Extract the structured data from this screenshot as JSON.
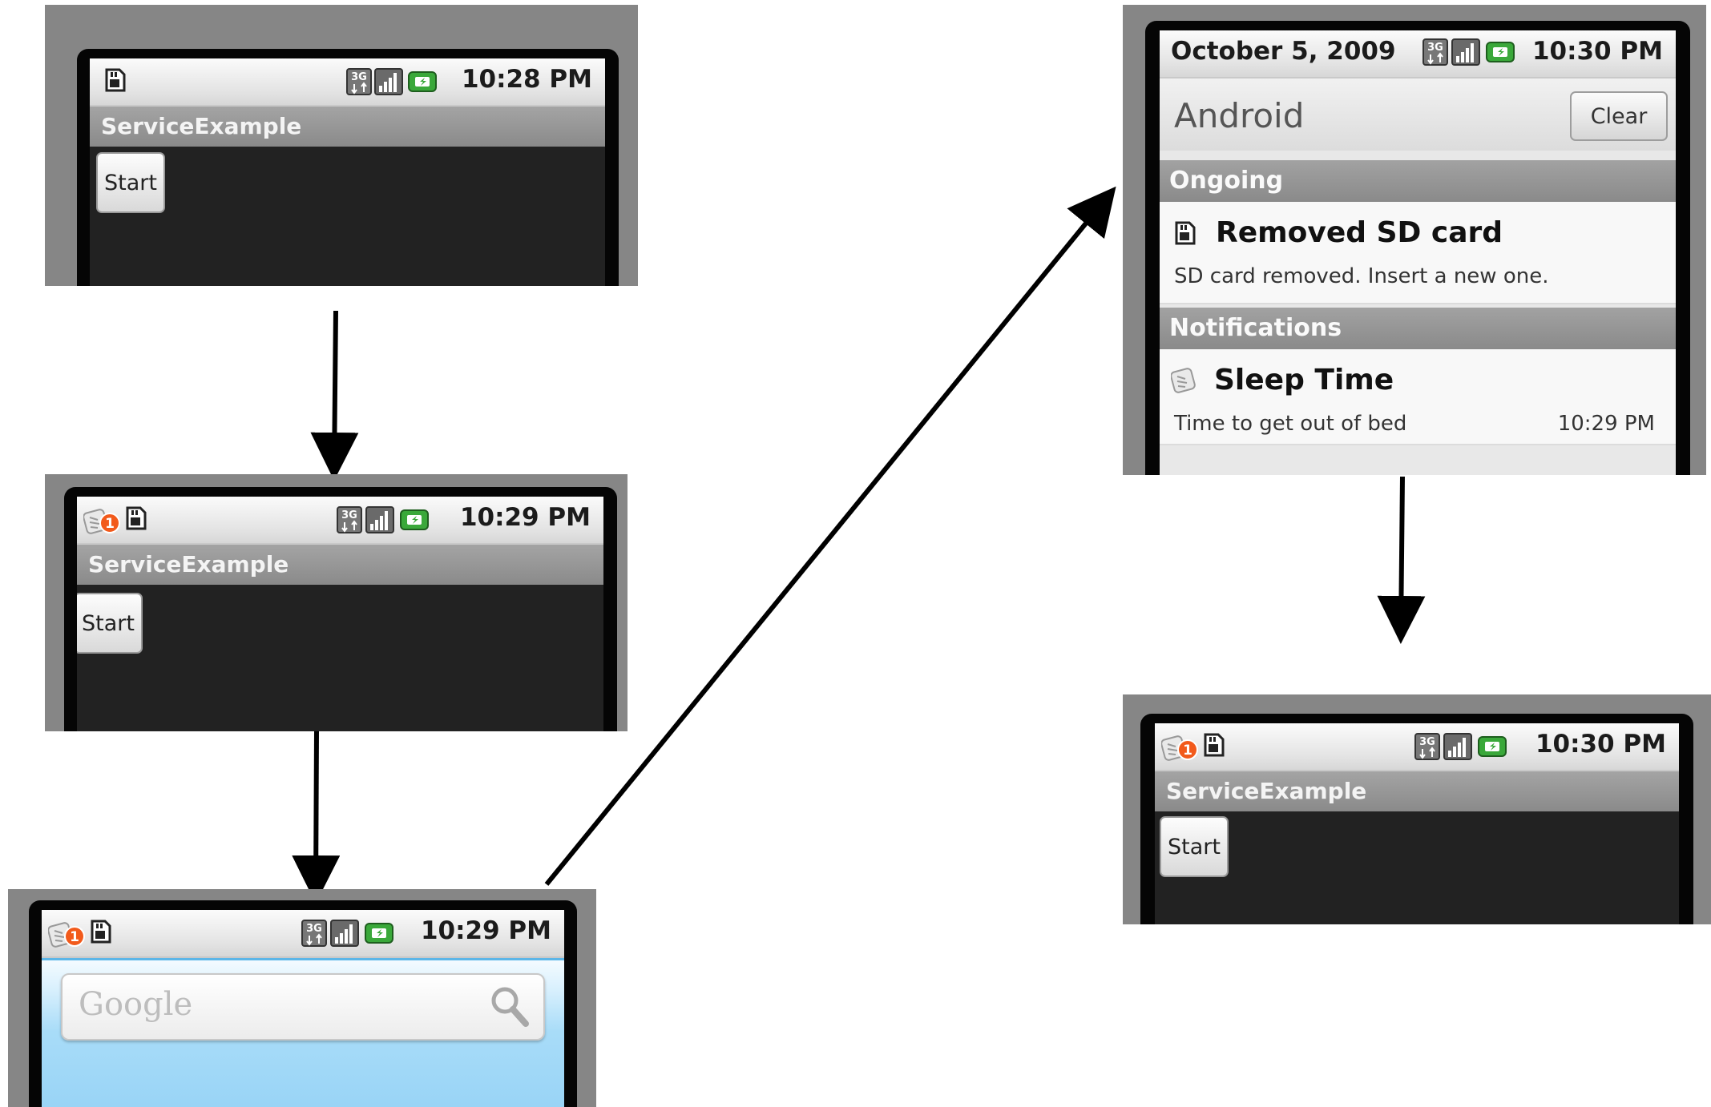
{
  "screens": {
    "s1": {
      "time": "10:28 PM",
      "app_title": "ServiceExample",
      "button": "Start"
    },
    "s2": {
      "time": "10:29 PM",
      "app_title": "ServiceExample",
      "button": "Start",
      "badge": "1"
    },
    "s3": {
      "time": "10:29 PM",
      "badge": "1",
      "search_placeholder": "Google"
    },
    "s4": {
      "date": "October 5, 2009",
      "time": "10:30 PM",
      "carrier": "Android",
      "clear_label": "Clear",
      "section_ongoing": "Ongoing",
      "ongoing_title": "Removed SD card",
      "ongoing_desc": "SD card removed. Insert a new one.",
      "section_notifications": "Notifications",
      "notif_title": "Sleep Time",
      "notif_desc": "Time to get out of bed",
      "notif_time": "10:29 PM"
    },
    "s5": {
      "time": "10:30 PM",
      "app_title": "ServiceExample",
      "button": "Start",
      "badge": "1"
    }
  },
  "colors": {
    "signal_green": "#3aa83a",
    "badge_orange": "#f25a1b",
    "arrow": "#000000"
  },
  "icons": [
    "sd-card-icon",
    "3g-icon",
    "signal-bars-icon",
    "battery-charging-icon",
    "alarm-clock-icon",
    "search-icon"
  ]
}
